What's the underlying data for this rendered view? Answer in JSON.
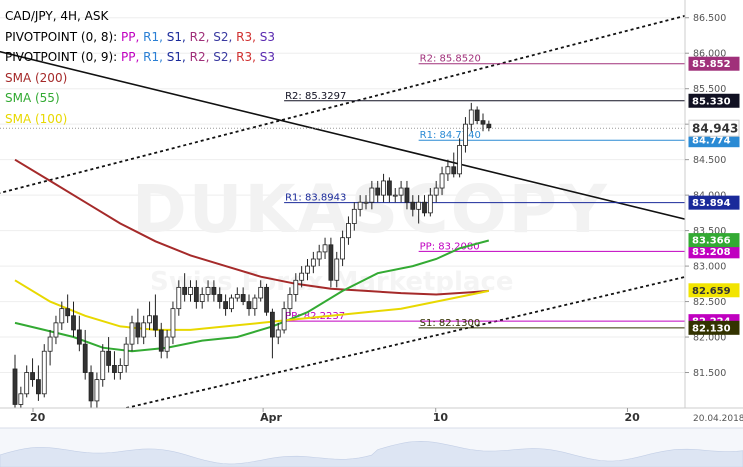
{
  "legend": {
    "symbol": "CAD/JPY, 4H, ASK",
    "pivot1_prefix": "PIVOTPOINT (0, 8):",
    "pivot2_prefix": "PIVOTPOINT (0, 9):",
    "pivot_items": [
      "PP",
      "R1",
      "S1",
      "R2",
      "S2",
      "R3",
      "S3"
    ],
    "pivot_colors": [
      "#c000c0",
      "#2a7fd4",
      "#1a2a9a",
      "#a0307a",
      "#3a3aa0",
      "#d03030",
      "#5a2ab0"
    ],
    "sma200": "SMA (200)",
    "sma55": "SMA (55)",
    "sma100": "SMA (100)",
    "sma200_color": "#a52a2a",
    "sma55_color": "#33aa33",
    "sma100_color": "#e8d800"
  },
  "watermark": "DUKASCOPY",
  "watermark_sub": "Swiss Forex Marketplace",
  "chart_data": {
    "type": "candlestick",
    "ylim": [
      81.0,
      86.75
    ],
    "yticks": [
      81.5,
      82.0,
      82.5,
      83.0,
      83.5,
      84.0,
      84.5,
      85.0,
      85.5,
      86.0,
      86.5
    ],
    "ytick_labels": [
      "81.500",
      "82.000",
      "82.500",
      "83.000",
      "83.500",
      "84.000",
      "84.500",
      "85.000",
      "85.500",
      "86.000",
      "86.500"
    ],
    "xticks": [
      {
        "label": "20",
        "date": "2018-03-20"
      },
      {
        "label": "Apr",
        "date": "2018-04-01"
      },
      {
        "label": "10",
        "date": "2018-04-10"
      },
      {
        "label": "20",
        "date": "2018-04-20"
      }
    ],
    "last_date_label": "20.04.2018",
    "candles_ohlc": [
      [
        81.55,
        81.75,
        81.0,
        81.05
      ],
      [
        81.05,
        81.3,
        80.95,
        81.2
      ],
      [
        81.2,
        81.6,
        81.15,
        81.5
      ],
      [
        81.5,
        81.7,
        81.3,
        81.4
      ],
      [
        81.4,
        81.6,
        81.1,
        81.2
      ],
      [
        81.2,
        81.9,
        81.15,
        81.8
      ],
      [
        81.8,
        82.1,
        81.6,
        82.0
      ],
      [
        82.0,
        82.3,
        81.9,
        82.2
      ],
      [
        82.2,
        82.5,
        82.1,
        82.4
      ],
      [
        82.4,
        82.6,
        82.2,
        82.3
      ],
      [
        82.3,
        82.5,
        82.0,
        82.1
      ],
      [
        82.1,
        82.3,
        81.8,
        81.9
      ],
      [
        81.9,
        82.1,
        81.4,
        81.5
      ],
      [
        81.5,
        81.6,
        81.0,
        81.1
      ],
      [
        81.1,
        81.5,
        81.0,
        81.4
      ],
      [
        81.4,
        81.9,
        81.3,
        81.8
      ],
      [
        81.8,
        82.0,
        81.5,
        81.6
      ],
      [
        81.6,
        81.8,
        81.4,
        81.5
      ],
      [
        81.5,
        81.7,
        81.4,
        81.6
      ],
      [
        81.6,
        82.0,
        81.5,
        81.9
      ],
      [
        81.9,
        82.3,
        81.8,
        82.2
      ],
      [
        82.2,
        82.4,
        81.9,
        82.0
      ],
      [
        82.0,
        82.3,
        81.9,
        82.2
      ],
      [
        82.2,
        82.5,
        82.1,
        82.3
      ],
      [
        82.3,
        82.6,
        82.0,
        82.1
      ],
      [
        82.1,
        82.2,
        81.7,
        81.8
      ],
      [
        81.8,
        82.1,
        81.7,
        82.0
      ],
      [
        82.0,
        82.5,
        81.9,
        82.4
      ],
      [
        82.4,
        82.8,
        82.3,
        82.7
      ],
      [
        82.7,
        82.9,
        82.5,
        82.6
      ],
      [
        82.6,
        82.8,
        82.5,
        82.7
      ],
      [
        82.7,
        82.8,
        82.4,
        82.5
      ],
      [
        82.5,
        82.7,
        82.4,
        82.6
      ],
      [
        82.6,
        82.8,
        82.5,
        82.7
      ],
      [
        82.7,
        82.8,
        82.5,
        82.6
      ],
      [
        82.6,
        82.7,
        82.4,
        82.5
      ],
      [
        82.5,
        82.6,
        82.3,
        82.4
      ],
      [
        82.4,
        82.6,
        82.35,
        82.55
      ],
      [
        82.55,
        82.7,
        82.5,
        82.6
      ],
      [
        82.6,
        82.7,
        82.45,
        82.5
      ],
      [
        82.5,
        82.6,
        82.3,
        82.4
      ],
      [
        82.4,
        82.6,
        82.3,
        82.55
      ],
      [
        82.55,
        82.8,
        82.5,
        82.7
      ],
      [
        82.7,
        82.75,
        82.3,
        82.35
      ],
      [
        82.35,
        82.4,
        81.7,
        82.0
      ],
      [
        82.0,
        82.2,
        81.9,
        82.1
      ],
      [
        82.1,
        82.5,
        82.05,
        82.4
      ],
      [
        82.4,
        82.7,
        82.3,
        82.6
      ],
      [
        82.6,
        82.9,
        82.5,
        82.8
      ],
      [
        82.8,
        83.0,
        82.7,
        82.9
      ],
      [
        82.9,
        83.1,
        82.8,
        83.0
      ],
      [
        83.0,
        83.2,
        82.9,
        83.1
      ],
      [
        83.1,
        83.3,
        83.0,
        83.2
      ],
      [
        83.2,
        83.4,
        83.1,
        83.3
      ],
      [
        83.3,
        83.4,
        82.7,
        82.8
      ],
      [
        82.8,
        83.2,
        82.7,
        83.1
      ],
      [
        83.1,
        83.5,
        83.0,
        83.4
      ],
      [
        83.4,
        83.7,
        83.3,
        83.6
      ],
      [
        83.6,
        83.9,
        83.5,
        83.8
      ],
      [
        83.8,
        84.0,
        83.7,
        83.9
      ],
      [
        83.9,
        84.0,
        83.8,
        83.9
      ],
      [
        83.9,
        84.2,
        83.8,
        84.1
      ],
      [
        84.1,
        84.2,
        83.9,
        84.0
      ],
      [
        84.0,
        84.3,
        83.9,
        84.2
      ],
      [
        84.2,
        84.25,
        83.9,
        84.0
      ],
      [
        84.0,
        84.1,
        83.9,
        84.0
      ],
      [
        84.0,
        84.2,
        83.9,
        84.1
      ],
      [
        84.1,
        84.2,
        83.8,
        83.9
      ],
      [
        83.9,
        84.0,
        83.7,
        83.8
      ],
      [
        83.8,
        84.0,
        83.6,
        83.9
      ],
      [
        83.9,
        84.0,
        83.7,
        83.75
      ],
      [
        83.75,
        84.1,
        83.7,
        84.0
      ],
      [
        84.0,
        84.2,
        83.9,
        84.1
      ],
      [
        84.1,
        84.4,
        84.0,
        84.3
      ],
      [
        84.3,
        84.5,
        84.2,
        84.4
      ],
      [
        84.4,
        84.6,
        84.25,
        84.3
      ],
      [
        84.3,
        84.8,
        84.25,
        84.7
      ],
      [
        84.7,
        85.1,
        84.6,
        85.0
      ],
      [
        85.0,
        85.3,
        84.9,
        85.2
      ],
      [
        85.2,
        85.25,
        85.0,
        85.05
      ],
      [
        85.05,
        85.15,
        84.9,
        85.0
      ],
      [
        85.0,
        85.05,
        84.9,
        84.95
      ]
    ],
    "series": [
      {
        "name": "SMA (200)",
        "color": "#a52a2a",
        "points": [
          [
            0,
            84.5
          ],
          [
            6,
            84.2
          ],
          [
            12,
            83.9
          ],
          [
            18,
            83.6
          ],
          [
            24,
            83.35
          ],
          [
            30,
            83.15
          ],
          [
            36,
            83.0
          ],
          [
            42,
            82.85
          ],
          [
            48,
            82.75
          ],
          [
            54,
            82.68
          ],
          [
            60,
            82.65
          ],
          [
            66,
            82.62
          ],
          [
            72,
            82.6
          ],
          [
            78,
            82.63
          ],
          [
            81,
            82.65
          ]
        ]
      },
      {
        "name": "SMA (55)",
        "color": "#33aa33",
        "points": [
          [
            0,
            82.2
          ],
          [
            5,
            82.1
          ],
          [
            10,
            82.0
          ],
          [
            15,
            81.85
          ],
          [
            20,
            81.8
          ],
          [
            26,
            81.85
          ],
          [
            32,
            81.95
          ],
          [
            38,
            82.0
          ],
          [
            44,
            82.15
          ],
          [
            50,
            82.35
          ],
          [
            56,
            82.65
          ],
          [
            62,
            82.9
          ],
          [
            68,
            83.0
          ],
          [
            72,
            83.1
          ],
          [
            76,
            83.25
          ],
          [
            81,
            83.36
          ]
        ]
      },
      {
        "name": "SMA (100)",
        "color": "#e8d800",
        "points": [
          [
            0,
            82.8
          ],
          [
            6,
            82.5
          ],
          [
            12,
            82.3
          ],
          [
            18,
            82.15
          ],
          [
            24,
            82.1
          ],
          [
            30,
            82.1
          ],
          [
            36,
            82.15
          ],
          [
            42,
            82.2
          ],
          [
            48,
            82.25
          ],
          [
            54,
            82.3
          ],
          [
            60,
            82.35
          ],
          [
            66,
            82.4
          ],
          [
            72,
            82.5
          ],
          [
            78,
            82.6
          ],
          [
            81,
            82.65
          ]
        ]
      }
    ],
    "trendlines": [
      {
        "style": "solid",
        "from": [
          -4,
          86.05
        ],
        "to": [
          125,
          83.45
        ]
      },
      {
        "style": "dotted",
        "from": [
          -4,
          84.0
        ],
        "to": [
          125,
          86.75
        ]
      },
      {
        "style": "dotted",
        "from": [
          19,
          81.0
        ],
        "to": [
          125,
          83.05
        ]
      }
    ],
    "pivot_levels": [
      {
        "label": "R2: 85.8520",
        "value": 85.852,
        "tag": "85.852",
        "color": "#a0307a",
        "from": 69
      },
      {
        "label": "R2: 85.3297",
        "value": 85.33,
        "tag": "85.330",
        "color": "#111122",
        "from": 46
      },
      {
        "label": "R1: 84.7740",
        "value": 84.774,
        "tag": "84.774",
        "color": "#2a8ad4",
        "from": 69
      },
      {
        "label": "R1: 83.8943",
        "value": 83.894,
        "tag": "83.894",
        "color": "#1a2a9a",
        "from": 46
      },
      {
        "label": "PP: 83.2080",
        "value": 83.208,
        "tag": "83.208",
        "color": "#c000c0",
        "from": 69
      },
      {
        "label": "PP: 82.2237",
        "value": 82.224,
        "tag": "82.224",
        "color": "#c000c0",
        "from": 46
      },
      {
        "label": "S1: 82.1300",
        "value": 82.13,
        "tag": "82.130",
        "color": "#333300",
        "from": 69
      }
    ],
    "price_tags": [
      {
        "value": 84.943,
        "label": "84.943",
        "color": "#ffffff",
        "text": "#333333",
        "big": true
      },
      {
        "value": 83.366,
        "label": "83.366",
        "color": "#33aa33",
        "text": "#ffffff"
      },
      {
        "value": 82.659,
        "label": "82.659",
        "color": "#f2e400",
        "text": "#333333"
      }
    ],
    "current_price": 84.943
  }
}
